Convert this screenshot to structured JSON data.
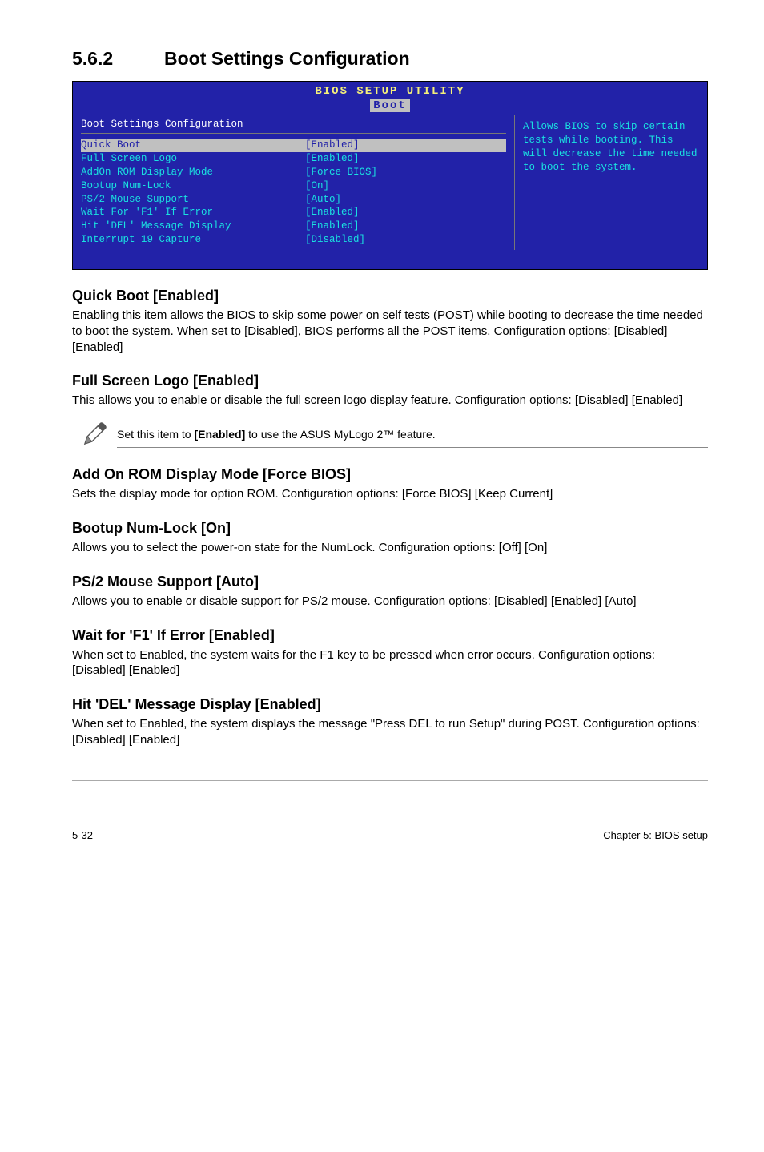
{
  "section": {
    "number": "5.6.2",
    "title": "Boot Settings Configuration"
  },
  "bios": {
    "title": "BIOS SETUP UTILITY",
    "tab": "Boot",
    "panel_title": "Boot Settings Configuration",
    "rows": [
      {
        "lbl": "Quick Boot",
        "val": "[Enabled]",
        "selected": true
      },
      {
        "lbl": "Full Screen Logo",
        "val": "[Enabled]",
        "selected": false
      },
      {
        "lbl": "AddOn ROM Display Mode",
        "val": "[Force BIOS]",
        "selected": false
      },
      {
        "lbl": "Bootup Num-Lock",
        "val": "[On]",
        "selected": false
      },
      {
        "lbl": "PS/2 Mouse Support",
        "val": "[Auto]",
        "selected": false
      },
      {
        "lbl": "Wait For 'F1' If Error",
        "val": "[Enabled]",
        "selected": false
      },
      {
        "lbl": "Hit 'DEL' Message Display",
        "val": "[Enabled]",
        "selected": false
      },
      {
        "lbl": "Interrupt 19 Capture",
        "val": "[Disabled]",
        "selected": false
      }
    ],
    "help": "Allows BIOS to skip certain tests while booting. This will decrease the time needed to boot the system."
  },
  "subs": {
    "quickboot": {
      "h": "Quick Boot [Enabled]",
      "p": "Enabling this item allows the BIOS to skip some power on self tests (POST) while booting to decrease the time needed to boot the system. When set to [Disabled], BIOS performs all the POST items. Configuration options: [Disabled] [Enabled]"
    },
    "fullscreen": {
      "h": "Full Screen Logo [Enabled]",
      "p": "This allows you to enable or disable the full screen logo display feature. Configuration options: [Disabled] [Enabled]"
    },
    "note": {
      "prefix": "Set this item to ",
      "bold": "[Enabled]",
      "suffix": " to use the ASUS MyLogo 2™ feature."
    },
    "addon": {
      "h": "Add On ROM Display Mode [Force BIOS]",
      "p": "Sets the display mode for option ROM. Configuration options: [Force BIOS] [Keep Current]"
    },
    "numlock": {
      "h": "Bootup Num-Lock [On]",
      "p": "Allows you to select the power-on state for the NumLock. Configuration options: [Off] [On]"
    },
    "ps2": {
      "h": "PS/2 Mouse Support [Auto]",
      "p": "Allows you to enable or disable support for PS/2 mouse. Configuration options: [Disabled] [Enabled] [Auto]"
    },
    "waitf1": {
      "h": "Wait for 'F1' If Error [Enabled]",
      "p": "When set to Enabled, the system waits for the F1 key to be pressed when error occurs. Configuration options: [Disabled] [Enabled]"
    },
    "hitdel": {
      "h": "Hit 'DEL' Message Display [Enabled]",
      "p": "When set to Enabled, the system displays the message \"Press DEL to run Setup\" during POST. Configuration options: [Disabled] [Enabled]"
    }
  },
  "footer": {
    "left": "5-32",
    "right": "Chapter 5: BIOS setup"
  }
}
